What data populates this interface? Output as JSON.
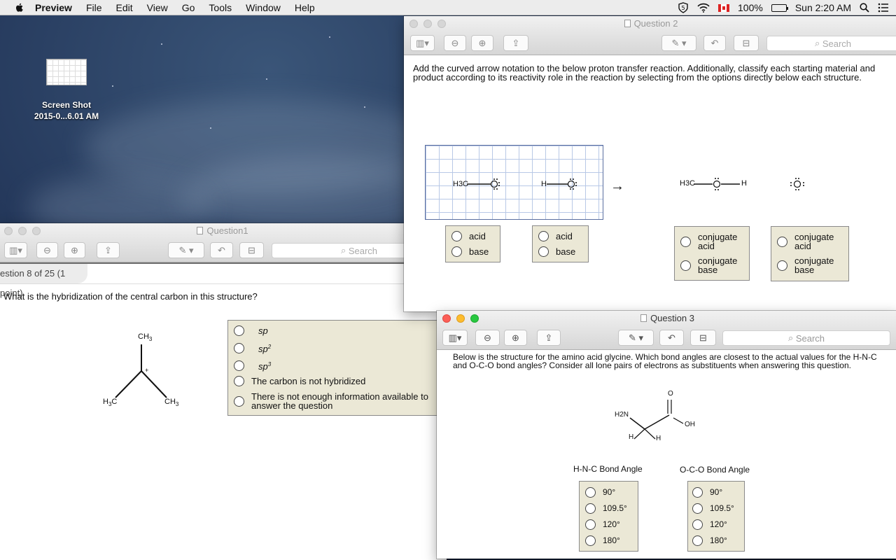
{
  "menubar": {
    "app": "Preview",
    "items": [
      "File",
      "Edit",
      "View",
      "Go",
      "Tools",
      "Window",
      "Help"
    ],
    "battery": "100%",
    "clock": "Sun 2:20 AM"
  },
  "desktop": {
    "icon_line1": "Screen Shot",
    "icon_line2": "2015-0...6.01 AM"
  },
  "toolbar": {
    "search_placeholder": "Search"
  },
  "question1": {
    "title": "Question1",
    "header": "estion 8 of 25 (1 point)",
    "prompt": "What is the hybridization of the central carbon in this structure?",
    "structure": {
      "top": "CH",
      "top_sub": "3",
      "left": "H",
      "left_sub": "3",
      "left_tail": "C",
      "right": "CH",
      "right_sub": "3",
      "charge": "+"
    },
    "options": [
      {
        "label": "sp",
        "sup": ""
      },
      {
        "label": "sp",
        "sup": "2"
      },
      {
        "label": "sp",
        "sup": "3"
      },
      {
        "label": "The carbon is not hybridized",
        "sup": ""
      },
      {
        "label": "There is not enough information available to answer the question",
        "sup": ""
      }
    ]
  },
  "question2": {
    "title": "Question 2",
    "prompt": "Add the curved arrow notation to the below proton transfer reaction. Additionally, classify each starting material and product according to its reactivity role in the reaction by selecting from the options directly below each structure.",
    "reactant1": "H3C",
    "reactant2": "H",
    "product1_left": "H3C",
    "product1_right": "H",
    "arrow": "→",
    "choices_reactant1": [
      "acid",
      "base"
    ],
    "choices_reactant2": [
      "acid",
      "base"
    ],
    "choices_product1": [
      "conjugate acid",
      "conjugate base"
    ],
    "choices_product2": [
      "conjugate acid",
      "conjugate base"
    ]
  },
  "question3": {
    "title": "Question 3",
    "prompt": "Below is the structure for the amino acid glycine.  Which bond angles are closest to the actual values for the H-N-C and O-C-O bond angles?  Consider all lone pairs of electrons as substituents when answering this question.",
    "structure": {
      "amine": "H2N",
      "oxygen": "O",
      "hydroxyl": "OH",
      "h": "H"
    },
    "hnc_title": "H-N-C Bond Angle",
    "oco_title": "O-C-O Bond Angle",
    "angles": [
      "90°",
      "109.5°",
      "120°",
      "180°"
    ]
  },
  "colors": {
    "option_bg": "#ebe8d6",
    "grid_line": "#b8c8e6"
  }
}
